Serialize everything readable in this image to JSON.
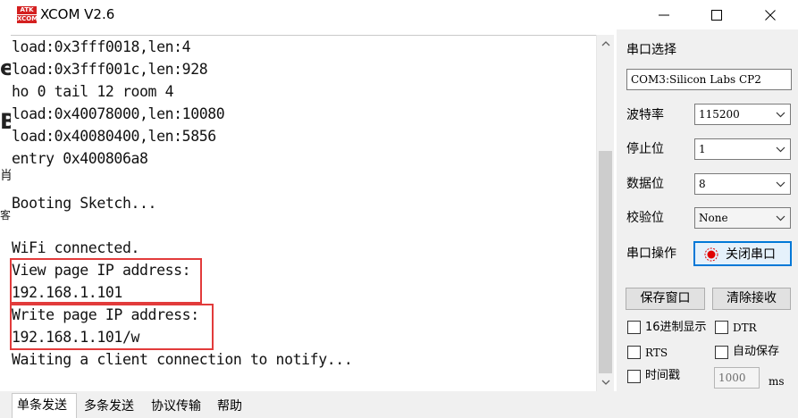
{
  "window": {
    "logo_line1": "ATK",
    "logo_line2": "XCOM",
    "title": "XCOM V2.6",
    "controls": [
      "minimize",
      "maximize",
      "close"
    ]
  },
  "background_page_fragments": [
    "e",
    "B",
    "肖",
    "客"
  ],
  "receive_area": {
    "lines": [
      "load:0x3fff0018,len:4",
      "load:0x3fff001c,len:928",
      "ho 0 tail 12 room 4",
      "load:0x40078000,len:10080",
      "load:0x40080400,len:5856",
      "entry 0x400806a8",
      "",
      "Booting Sketch...",
      "",
      "WiFi connected.",
      "View page IP address:",
      "192.168.1.101",
      "Write page IP address:",
      "192.168.1.101/w",
      "Waiting a client connection to notify..."
    ],
    "highlight_color": "#e23b3b"
  },
  "tabs": [
    {
      "label": "单条发送",
      "active": true
    },
    {
      "label": "多条发送",
      "active": false
    },
    {
      "label": "协议传输",
      "active": false
    },
    {
      "label": "帮助",
      "active": false
    }
  ],
  "serial_panel": {
    "port_select_label": "串口选择",
    "port_value": "COM3:Silicon Labs CP2",
    "baud_label": "波特率",
    "baud_value": "115200",
    "stop_label": "停止位",
    "stop_value": "1",
    "data_label": "数据位",
    "data_value": "8",
    "parity_label": "校验位",
    "parity_value": "None",
    "operation_label": "串口操作",
    "close_port_button": "关闭串口",
    "port_open_indicator_color": "#e00000",
    "save_window_button": "保存窗口",
    "clear_receive_button": "清除接收",
    "hex_display": {
      "label": "16进制显示",
      "checked": false
    },
    "dtr": {
      "label": "DTR",
      "checked": false
    },
    "rts": {
      "label": "RTS",
      "checked": false
    },
    "auto_save": {
      "label": "自动保存",
      "checked": false
    },
    "timestamp": {
      "label": "时间戳",
      "checked": false
    },
    "timestamp_interval": "1000",
    "timestamp_unit": "ms"
  },
  "colors": {
    "accent": "#0078d7",
    "panel_bg": "#f0f0f0",
    "highlight": "#e23b3b"
  }
}
